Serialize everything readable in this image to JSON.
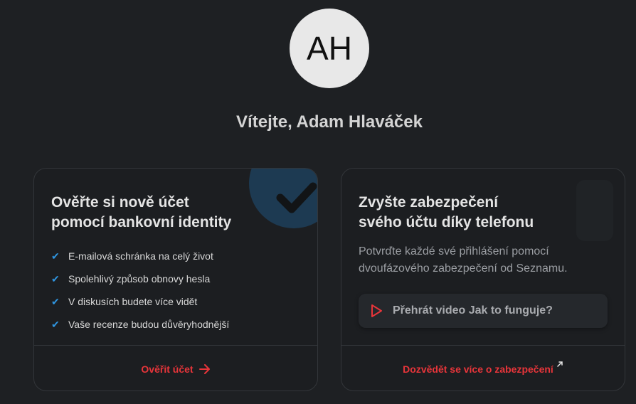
{
  "user": {
    "initials": "AH",
    "welcome": "Vítejte, Adam Hlaváček"
  },
  "cards": {
    "bank": {
      "title_line1": "Ověřte si nově účet",
      "title_line2": "pomocí bankovní identity",
      "features": [
        "E-mailová schránka na celý život",
        "Spolehlivý způsob obnovy hesla",
        "V diskusích budete více vidět",
        "Vaše recenze budou důvěryhodnější"
      ],
      "link": "Ověřit účet",
      "icon": "check-icon"
    },
    "security": {
      "title_line1": "Zvyšte zabezpečení",
      "title_line2": "svého účtu díky telefonu",
      "description": "Potvrďte každé své přihlášení pomocí dvoufázového zabezpečení od Seznamu.",
      "video_label": "Přehrát video Jak to funguje?",
      "link": "Dozvědět se více o zabezpečení",
      "icon": "play-icon"
    }
  },
  "colors": {
    "background": "#1e2023",
    "accent": "#e8353a",
    "check": "#2f95e0"
  }
}
